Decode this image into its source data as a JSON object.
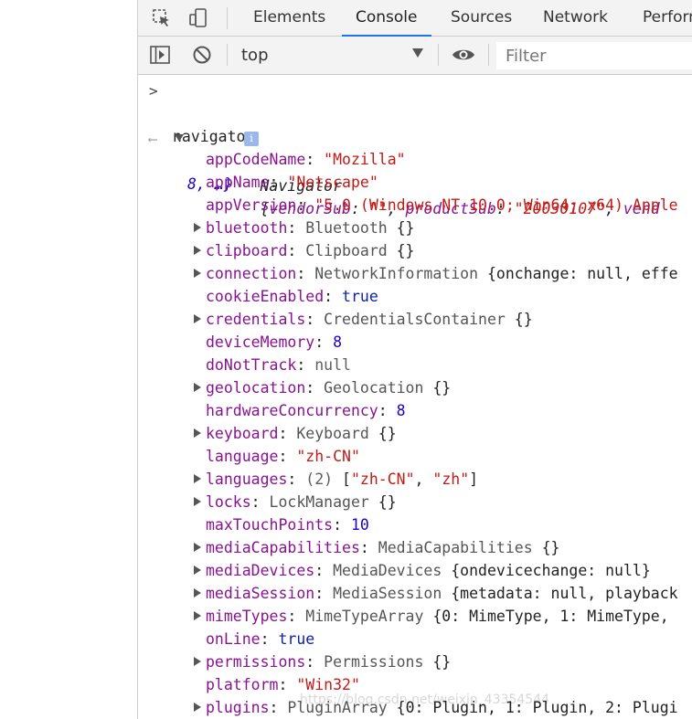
{
  "tabs": [
    "Elements",
    "Console",
    "Sources",
    "Network",
    "Perform"
  ],
  "toolbar": {
    "context": "top",
    "filter_placeholder": "Filter"
  },
  "input": {
    "prompt": ">",
    "command": "navigator"
  },
  "summary": {
    "class": "Navigator",
    "open": "{",
    "p1_key": "vendorSub",
    "p1_val": "\"\"",
    "p2_key": "productSub",
    "p2_val": "\"20030107\"",
    "p3_key": "vend",
    "cont": "8, …}",
    "info": "i"
  },
  "props": [
    {
      "key": "appCodeName",
      "val": "\"Mozilla\"",
      "t": "s",
      "exp": false
    },
    {
      "key": "appName",
      "val": "\"Netscape\"",
      "t": "s",
      "exp": false
    },
    {
      "key": "appVersion",
      "val": "\"5.0 (Windows NT 10.0; Win64; x64) Apple",
      "t": "s",
      "exp": false
    },
    {
      "key": "bluetooth",
      "cls": "Bluetooth",
      "val": "{}",
      "exp": true
    },
    {
      "key": "clipboard",
      "cls": "Clipboard",
      "val": "{}",
      "exp": true
    },
    {
      "key": "connection",
      "cls": "NetworkInformation",
      "val": "{onchange: null, effe",
      "exp": true
    },
    {
      "key": "cookieEnabled",
      "val": "true",
      "t": "b",
      "exp": false
    },
    {
      "key": "credentials",
      "cls": "CredentialsContainer",
      "val": "{}",
      "exp": true
    },
    {
      "key": "deviceMemory",
      "val": "8",
      "t": "n",
      "exp": false
    },
    {
      "key": "doNotTrack",
      "val": "null",
      "t": "nl",
      "exp": false
    },
    {
      "key": "geolocation",
      "cls": "Geolocation",
      "val": "{}",
      "exp": true
    },
    {
      "key": "hardwareConcurrency",
      "val": "8",
      "t": "n",
      "exp": false
    },
    {
      "key": "keyboard",
      "cls": "Keyboard",
      "val": "{}",
      "exp": true
    },
    {
      "key": "language",
      "val": "\"zh-CN\"",
      "t": "s",
      "exp": false
    },
    {
      "key": "languages",
      "arr": true,
      "cls": "(2)",
      "val": "",
      "exp": true
    },
    {
      "key": "locks",
      "cls": "LockManager",
      "val": "{}",
      "exp": true
    },
    {
      "key": "maxTouchPoints",
      "val": "10",
      "t": "n",
      "exp": false
    },
    {
      "key": "mediaCapabilities",
      "cls": "MediaCapabilities",
      "val": "{}",
      "exp": true
    },
    {
      "key": "mediaDevices",
      "cls": "MediaDevices",
      "val": "{ondevicechange: null}",
      "exp": true
    },
    {
      "key": "mediaSession",
      "cls": "MediaSession",
      "val": "{metadata: null, playback",
      "exp": true
    },
    {
      "key": "mimeTypes",
      "cls": "MimeTypeArray",
      "val": "{0: MimeType, 1: MimeType,",
      "exp": true
    },
    {
      "key": "onLine",
      "val": "true",
      "t": "b",
      "exp": false
    },
    {
      "key": "permissions",
      "cls": "Permissions",
      "val": "{}",
      "exp": true
    },
    {
      "key": "platform",
      "val": "\"Win32\"",
      "t": "s",
      "exp": false
    },
    {
      "key": "plugins",
      "cls": "PluginArray",
      "val": "{0: Plugin, 1: Plugin, 2: Plugi",
      "exp": true
    }
  ],
  "languages_items": [
    "\"zh-CN\"",
    "\"zh\""
  ],
  "watermark": "https://blog.csdn.net/weixin_43354544"
}
